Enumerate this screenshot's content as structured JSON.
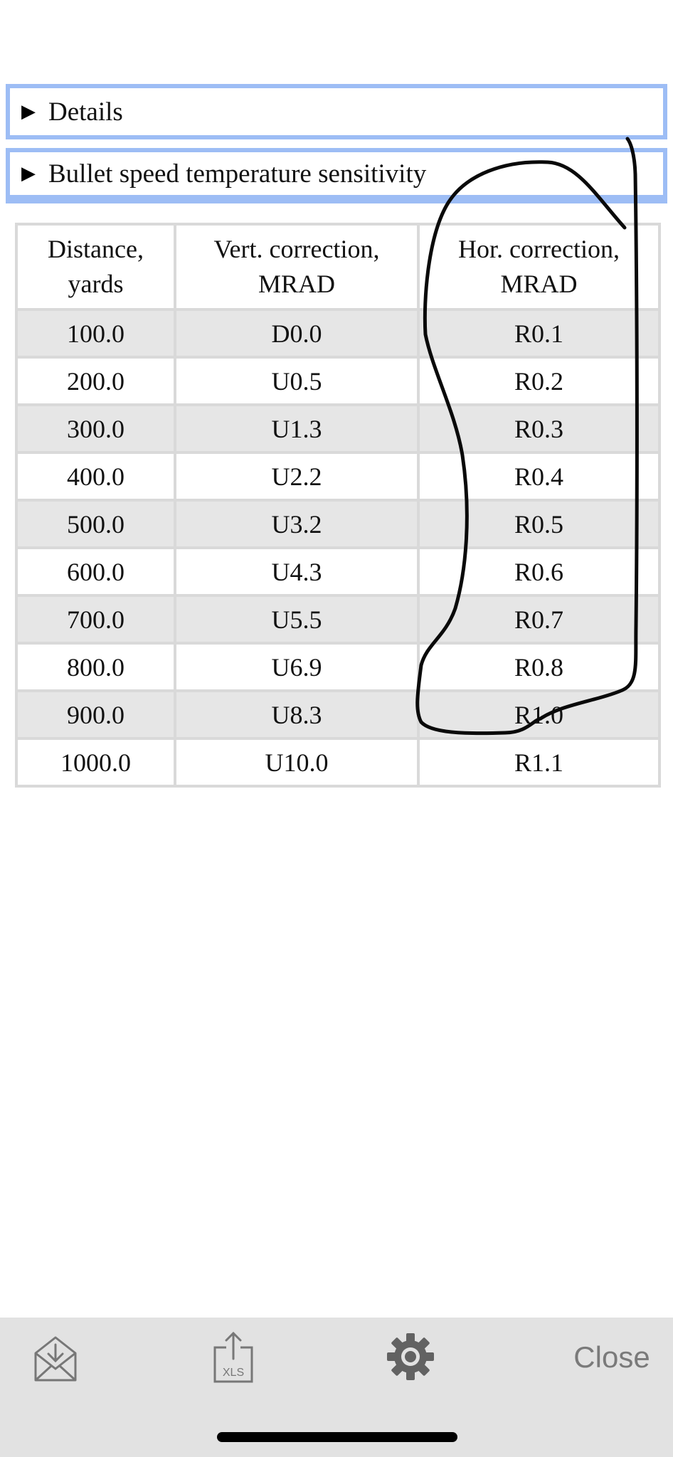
{
  "sections": {
    "details_label": "Details",
    "bullet_label": "Bullet speed temperature sensitivity"
  },
  "table": {
    "headers": [
      {
        "line1": "Distance,",
        "line2": "yards"
      },
      {
        "line1": "Vert. correction,",
        "line2": "MRAD"
      },
      {
        "line1": "Hor. correction,",
        "line2": "MRAD"
      }
    ],
    "rows": [
      [
        "100.0",
        "D0.0",
        "R0.1"
      ],
      [
        "200.0",
        "U0.5",
        "R0.2"
      ],
      [
        "300.0",
        "U1.3",
        "R0.3"
      ],
      [
        "400.0",
        "U2.2",
        "R0.4"
      ],
      [
        "500.0",
        "U3.2",
        "R0.5"
      ],
      [
        "600.0",
        "U4.3",
        "R0.6"
      ],
      [
        "700.0",
        "U5.5",
        "R0.7"
      ],
      [
        "800.0",
        "U6.9",
        "R0.8"
      ],
      [
        "900.0",
        "U8.3",
        "R1.0"
      ],
      [
        "1000.0",
        "U10.0",
        "R1.1"
      ]
    ]
  },
  "toolbar": {
    "xls_text": "XLS",
    "close_label": "Close",
    "icons": [
      "mail-download-icon",
      "xls-export-icon",
      "gear-icon"
    ]
  },
  "colors": {
    "section_border": "#9dbdf5",
    "row_shade": "#e6e6e6",
    "grid": "#d9d9d9",
    "toolbar_bg": "#e2e2e2",
    "close_text": "#7a7a7a"
  }
}
